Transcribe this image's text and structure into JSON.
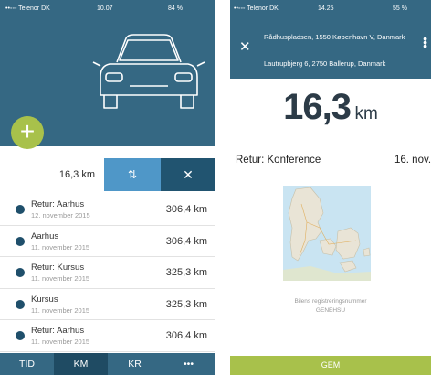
{
  "left": {
    "status": {
      "carrier": "••◦◦◦ Telenor DK",
      "time": "10.07",
      "battery": "84 %"
    },
    "trip_bar": {
      "distance": "16,3 km"
    },
    "trips": [
      {
        "title": "Retur: Aarhus",
        "date": "12. november 2015",
        "km": "306,4 km"
      },
      {
        "title": "Aarhus",
        "date": "11. november 2015",
        "km": "306,4 km"
      },
      {
        "title": "Retur: Kursus",
        "date": "11. november 2015",
        "km": "325,3 km"
      },
      {
        "title": "Kursus",
        "date": "11. november 2015",
        "km": "325,3 km"
      },
      {
        "title": "Retur: Aarhus",
        "date": "11. november 2015",
        "km": "306,4 km"
      }
    ],
    "tabs": [
      {
        "label": "TID",
        "active": false
      },
      {
        "label": "KM",
        "active": true
      },
      {
        "label": "KR",
        "active": false
      },
      {
        "label": "•••",
        "active": false
      }
    ]
  },
  "right": {
    "status": {
      "carrier": "••◦◦◦ Telenor DK",
      "time": "14.25",
      "battery": "55 %"
    },
    "from": "Rådhuspladsen, 1550 København V, Danmark",
    "to": "Lautrupbjerg 6, 2750 Ballerup, Danmark",
    "distance": {
      "value": "16,3",
      "unit": "km"
    },
    "purpose": "Retur: Konference",
    "date": "16. nov.",
    "plate_label": "Bilens registreringsnummer",
    "plate": "GENEHSU",
    "save_label": "GEM"
  },
  "colors": {
    "header_blue": "#356883",
    "dark_blue": "#1f4b63",
    "accent_blue": "#4f97c8",
    "green": "#a8c14b"
  },
  "icons": {
    "add": "plus-icon",
    "swap": "swap-arrows-icon",
    "close": "close-icon",
    "menu": "more-vertical-icon"
  }
}
